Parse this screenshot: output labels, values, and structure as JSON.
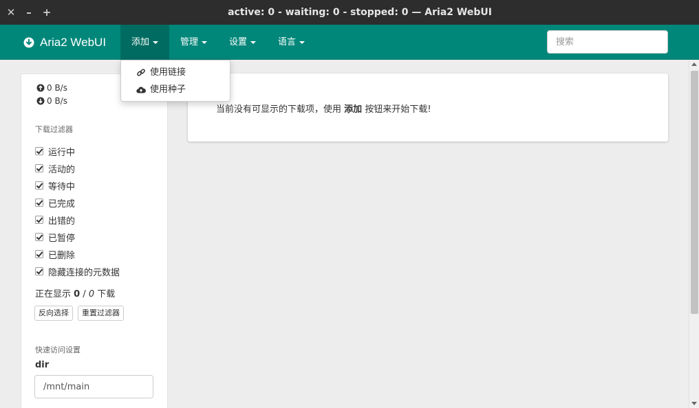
{
  "window": {
    "title": "active: 0 - waiting: 0 - stopped: 0 — Aria2 WebUI",
    "close_glyph": "✕",
    "minimize_glyph": "–",
    "maximize_glyph": "+"
  },
  "navbar": {
    "brand": "Aria2 WebUI",
    "brand_icon": "download-circle-icon",
    "menu": {
      "add": "添加",
      "manage": "管理",
      "settings": "设置",
      "language": "语言"
    },
    "search_placeholder": "搜索",
    "color": "#00877a"
  },
  "dropdown": {
    "use_link": "使用链接",
    "use_torrent": "使用种子"
  },
  "sidebar": {
    "upload_speed": "0 B/s",
    "download_speed": "0 B/s",
    "filter_title": "下载过滤器",
    "filters": {
      "running": "运行中",
      "active": "活动的",
      "waiting": "等待中",
      "completed": "已完成",
      "error": "出错的",
      "paused": "已暂停",
      "removed": "已删除",
      "hide_metadata": "隐藏连接的元数据"
    },
    "showing": {
      "prefix": "正在显示",
      "shown": "0",
      "sep": "/",
      "total": "0",
      "suffix": "下载"
    },
    "invert_button": "反向选择",
    "reset_button": "重置过滤器",
    "quick_title": "快速访问设置",
    "dir_label": "dir",
    "dir_value": "/mnt/main"
  },
  "main": {
    "msg_prefix": "当前没有可显示的下载项，使用",
    "msg_bold": "添加",
    "msg_suffix": "按钮来开始下载!"
  }
}
